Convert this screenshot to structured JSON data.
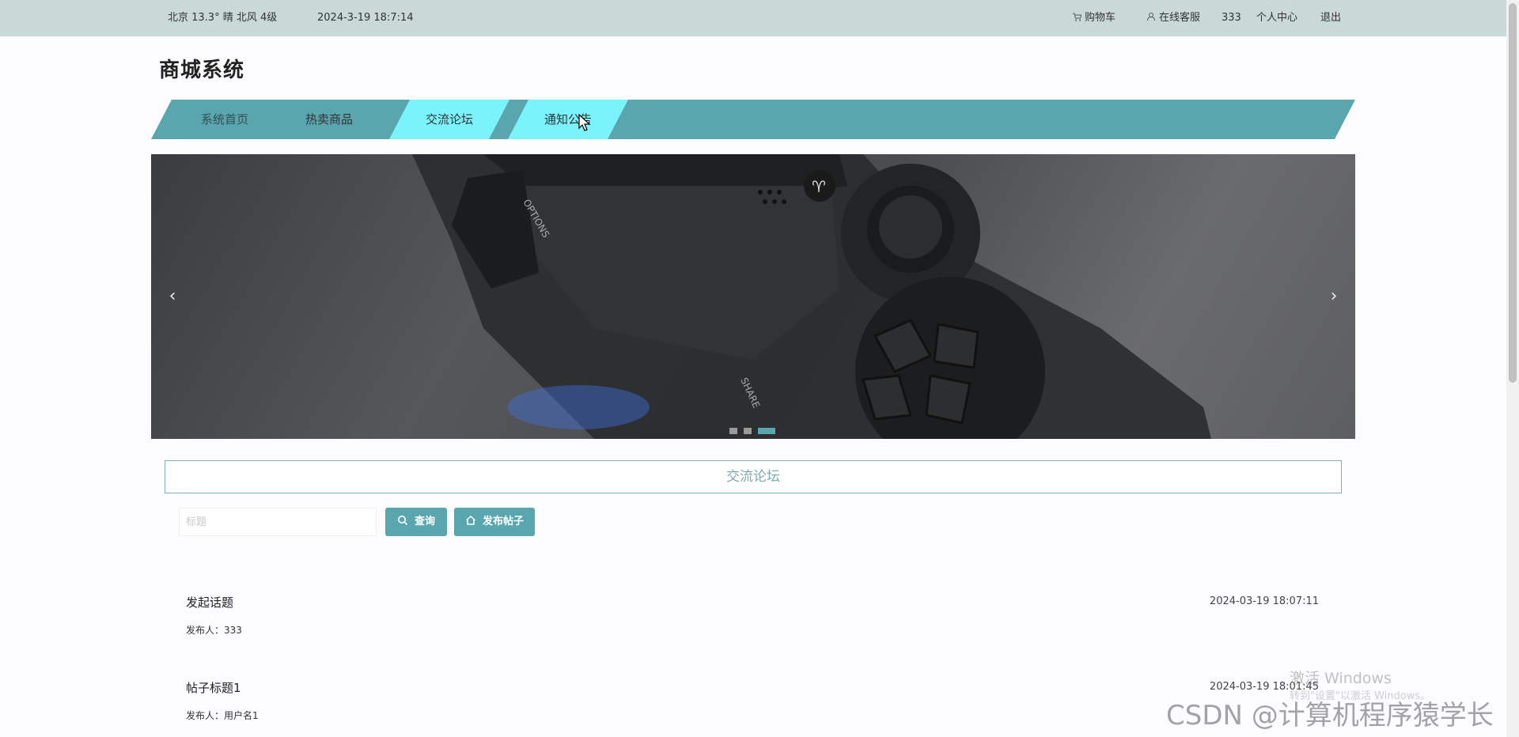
{
  "topbar": {
    "weather": "北京  13.3°  晴  北风  4级",
    "datetime": "2024-3-19 18:7:14",
    "cart": "购物车",
    "service": "在线客服",
    "username": "333",
    "profile": "个人中心",
    "logout": "退出"
  },
  "logo": "商城系统",
  "nav": {
    "items": [
      {
        "label": "系统首页"
      },
      {
        "label": "热卖商品"
      },
      {
        "label": "交流论坛"
      },
      {
        "label": "通知公告"
      }
    ],
    "highlighted": [
      "交流论坛",
      "通知公告"
    ]
  },
  "banner": {
    "prev_icon": "chevron-left-icon",
    "next_icon": "chevron-right-icon",
    "slide_count": 3,
    "active_slide": 3
  },
  "forum": {
    "section_title": "交流论坛",
    "search_placeholder": "标题",
    "search_button": "查询",
    "post_button": "发布帖子",
    "posts": [
      {
        "title": "发起话题",
        "author": "发布人：333",
        "time": "2024-03-19 18:07:11"
      },
      {
        "title": "帖子标题1",
        "author": "发布人：用户名1",
        "time": "2024-03-19 18:01:45"
      }
    ]
  },
  "watermarks": {
    "windows": "激活 Windows",
    "windows_sub": "转到\"设置\"以激活 Windows。",
    "csdn": "CSDN @计算机程序猿学长"
  },
  "colors": {
    "accent": "#5aa6ae",
    "nav_highlight": "#7af3fb",
    "topbar": "#c9d9d7"
  }
}
